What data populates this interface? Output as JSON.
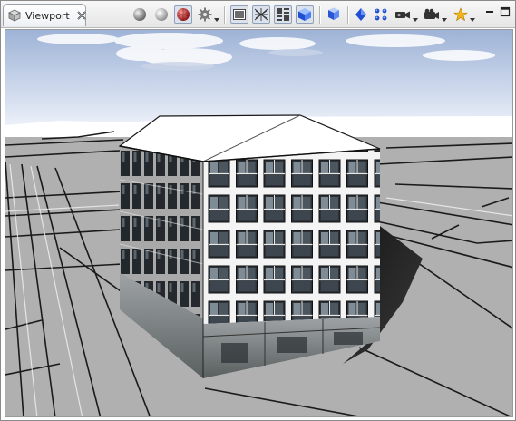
{
  "tab": {
    "title": "Viewport"
  },
  "toolbar": {
    "tools": [
      "shaded-sphere-icon",
      "smooth-sphere-icon",
      "textured-sphere-icon",
      "gear-settings-icon",
      "image-background-icon",
      "wireframe-icon",
      "grid-layout-icon",
      "blue-cube-icon",
      "blue-layers-icon",
      "blue-diamond-icon",
      "blue-nodes-icon",
      "camera-icon",
      "film-camera-icon",
      "star-favorites-icon"
    ]
  },
  "colors": {
    "sky_top": "#9eb3d6",
    "sky_bottom": "#ffffff",
    "ground": "#b0b0b0",
    "roof": "#ffffff",
    "facade": "#f4f4f4",
    "window_glass": "#2c3238"
  }
}
